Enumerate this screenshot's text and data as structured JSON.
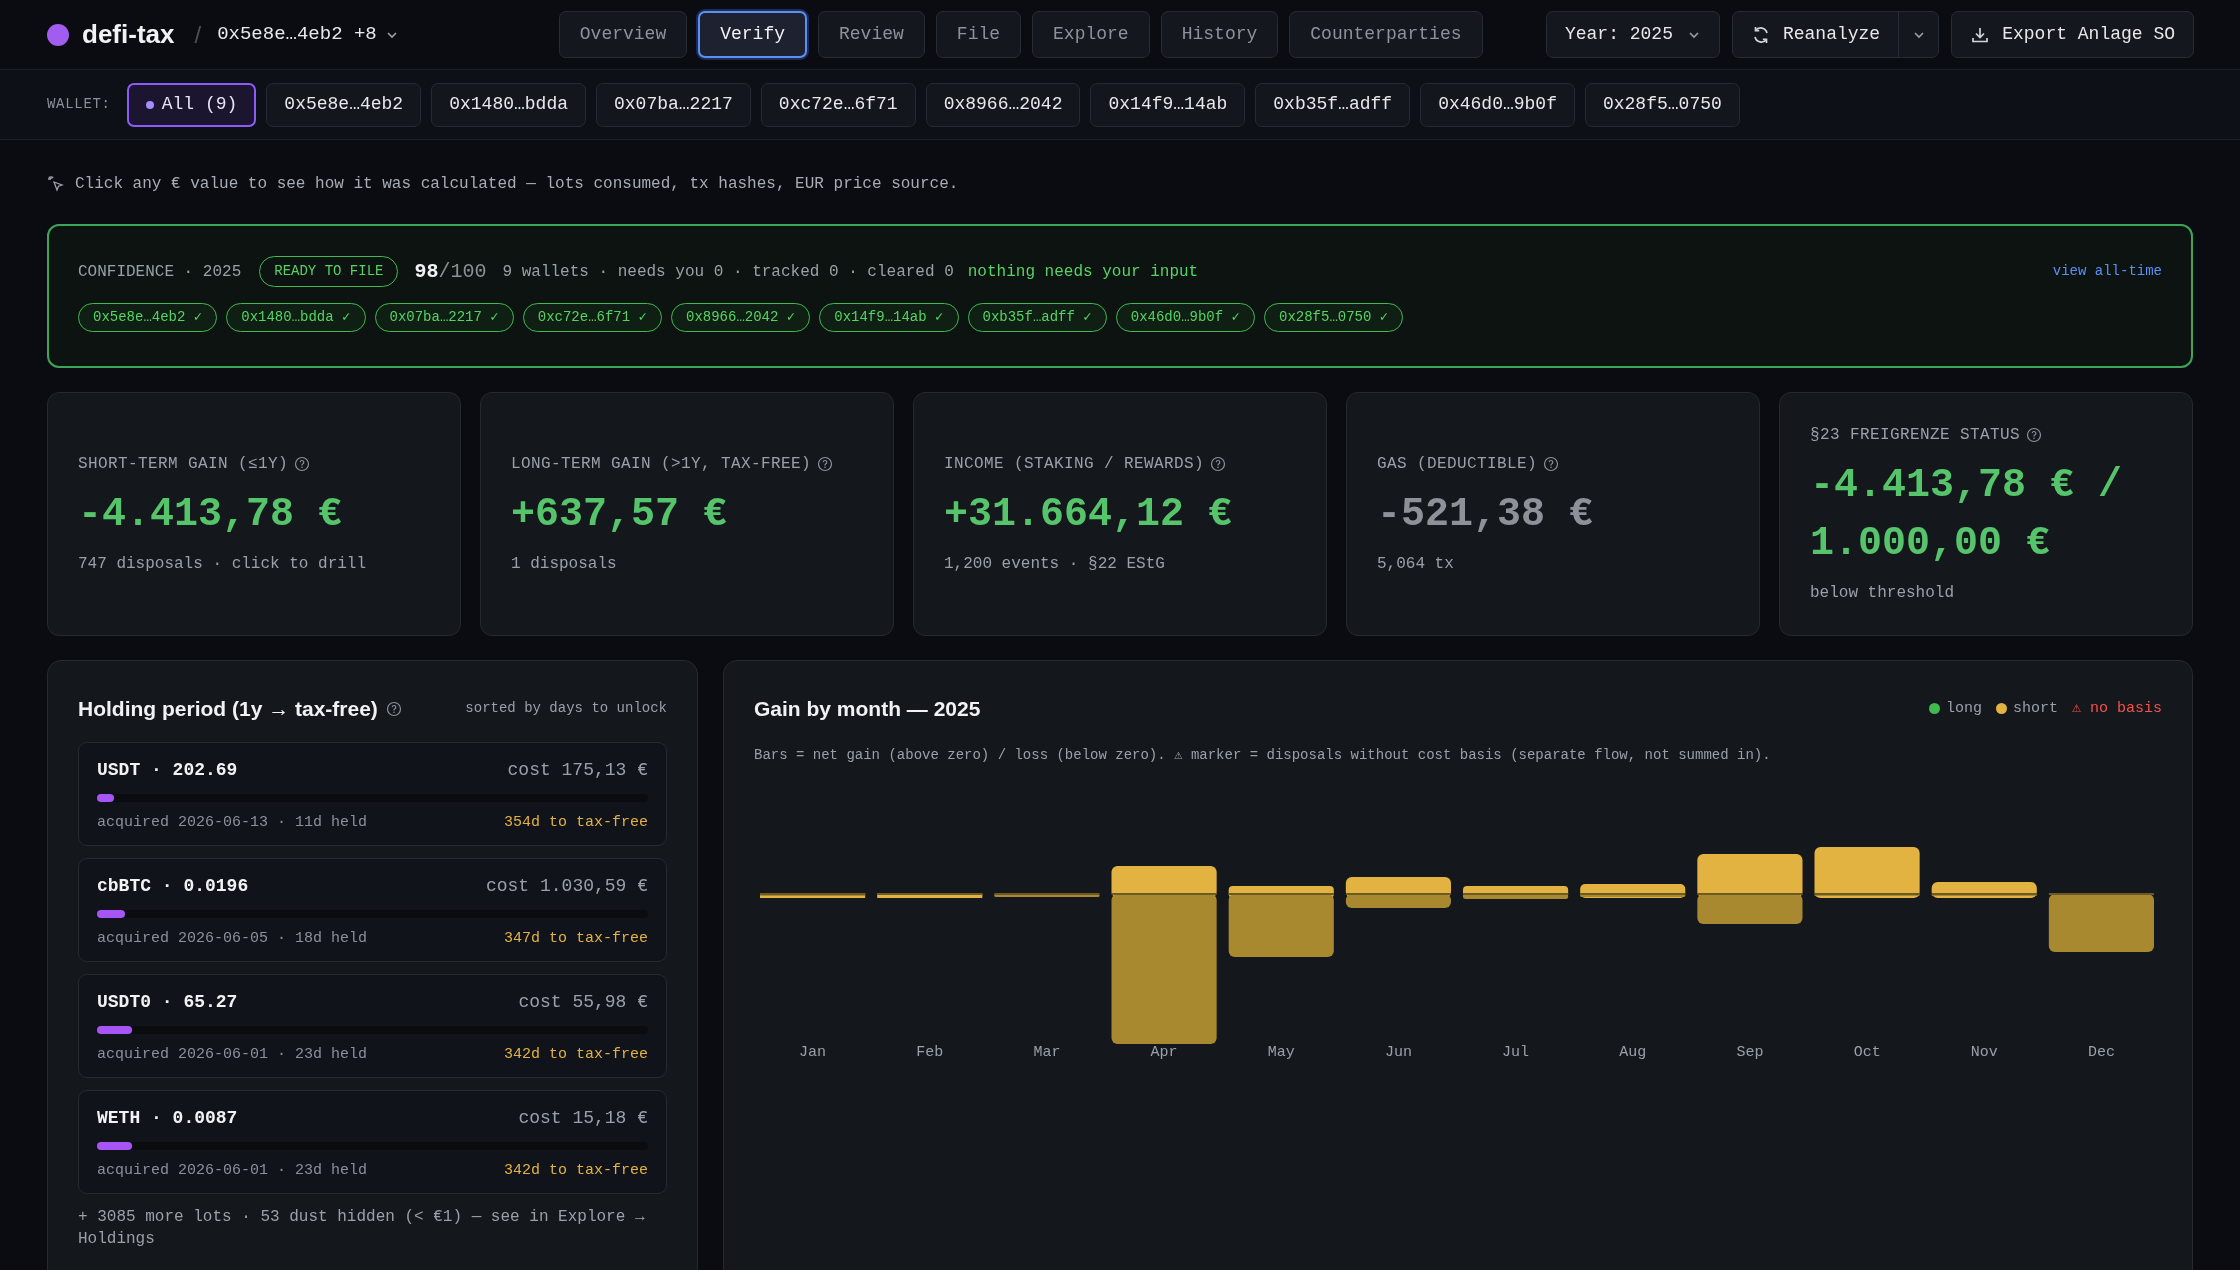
{
  "app": {
    "name": "defi-tax",
    "separator": "/",
    "wallet_selector": "0x5e8e…4eb2 +8"
  },
  "tabs": [
    {
      "label": "Overview",
      "selected": false
    },
    {
      "label": "Verify",
      "selected": true
    },
    {
      "label": "Review",
      "selected": false
    },
    {
      "label": "File",
      "selected": false
    },
    {
      "label": "Explore",
      "selected": false
    },
    {
      "label": "History",
      "selected": false
    },
    {
      "label": "Counterparties",
      "selected": false
    }
  ],
  "actions": {
    "year": "Year: 2025",
    "reanalyze": "Reanalyze",
    "export": "Export Anlage SO"
  },
  "wallet_bar": {
    "label": "WALLET:",
    "chips": [
      {
        "label": "All (9)",
        "selected": true
      },
      {
        "label": "0x5e8e…4eb2",
        "selected": false
      },
      {
        "label": "0x1480…bdda",
        "selected": false
      },
      {
        "label": "0x07ba…2217",
        "selected": false
      },
      {
        "label": "0xc72e…6f71",
        "selected": false
      },
      {
        "label": "0x8966…2042",
        "selected": false
      },
      {
        "label": "0x14f9…14ab",
        "selected": false
      },
      {
        "label": "0xb35f…adff",
        "selected": false
      },
      {
        "label": "0x46d0…9b0f",
        "selected": false
      },
      {
        "label": "0x28f5…0750",
        "selected": false
      }
    ]
  },
  "hint": "Click any € value to see how it was calculated — lots consumed, tx hashes, EUR price source.",
  "confidence": {
    "label": "CONFIDENCE · 2025",
    "badge": "READY TO FILE",
    "score": "98",
    "score_max": "/100",
    "stats": "9 wallets · needs you 0 · tracked 0 · cleared 0",
    "status": "nothing needs your input",
    "link": "view all-time",
    "wallets": [
      "0x5e8e…4eb2 ✓",
      "0x1480…bdda ✓",
      "0x07ba…2217 ✓",
      "0xc72e…6f71 ✓",
      "0x8966…2042 ✓",
      "0x14f9…14ab ✓",
      "0xb35f…adff ✓",
      "0x46d0…9b0f ✓",
      "0x28f5…0750 ✓"
    ]
  },
  "stats": [
    {
      "label": "SHORT-TERM GAIN (≤1Y)",
      "value": "-4.413,78 €",
      "color": "#56c46a",
      "note": "747 disposals · click to drill"
    },
    {
      "label": "LONG-TERM GAIN (>1Y, TAX-FREE)",
      "value": "+637,57 €",
      "color": "#56c46a",
      "note": "1 disposals"
    },
    {
      "label": "INCOME (STAKING / REWARDS)",
      "value": "+31.664,12 €",
      "color": "#56c46a",
      "note": "1,200 events · §22 EStG"
    },
    {
      "label": "GAS (DEDUCTIBLE)",
      "value": "-521,38 €",
      "color": "#8d929a",
      "note": "5,064 tx"
    },
    {
      "label": "§23 FREIGRENZE STATUS",
      "value": "-4.413,78 € / 1.000,00 €",
      "color": "#56c46a",
      "note": "below threshold"
    }
  ],
  "holding": {
    "title": "Holding period (1y → tax-free)",
    "sort": "sorted by days to unlock",
    "lots": [
      {
        "asset": "USDT · 202.69",
        "cost": "cost 175,13 €",
        "level": 0.03,
        "acquired": "acquired 2026-06-13 · 11d held",
        "remaining": "354d to tax-free"
      },
      {
        "asset": "cbBTC · 0.0196",
        "cost": "cost 1.030,59 €",
        "level": 0.05,
        "acquired": "acquired 2026-06-05 · 18d held",
        "remaining": "347d to tax-free"
      },
      {
        "asset": "USDT0 · 65.27",
        "cost": "cost 55,98 €",
        "level": 0.063,
        "acquired": "acquired 2026-06-01 · 23d held",
        "remaining": "342d to tax-free"
      },
      {
        "asset": "WETH · 0.0087",
        "cost": "cost 15,18 €",
        "level": 0.063,
        "acquired": "acquired 2026-06-01 · 23d held",
        "remaining": "342d to tax-free"
      }
    ],
    "footer": "+ 3085 more lots · 53 dust hidden (< €1) — see in Explore → Holdings"
  },
  "gain_chart": {
    "title": "Gain by month — 2025",
    "legend": [
      {
        "label": "long",
        "kind": "dot",
        "color": "#3fb950"
      },
      {
        "label": "short",
        "kind": "dot",
        "color": "#e3b341"
      },
      {
        "label": "⚠ no basis",
        "kind": "warning",
        "color": "#f85149"
      }
    ],
    "caption": "Bars = net gain (above zero) / loss (below zero). ⚠ marker = disposals without cost basis (separate flow, not summed in).",
    "months": [
      "Jan",
      "Feb",
      "Mar",
      "Apr",
      "May",
      "Jun",
      "Jul",
      "Aug",
      "Sep",
      "Oct",
      "Nov",
      "Dec"
    ]
  }
}
